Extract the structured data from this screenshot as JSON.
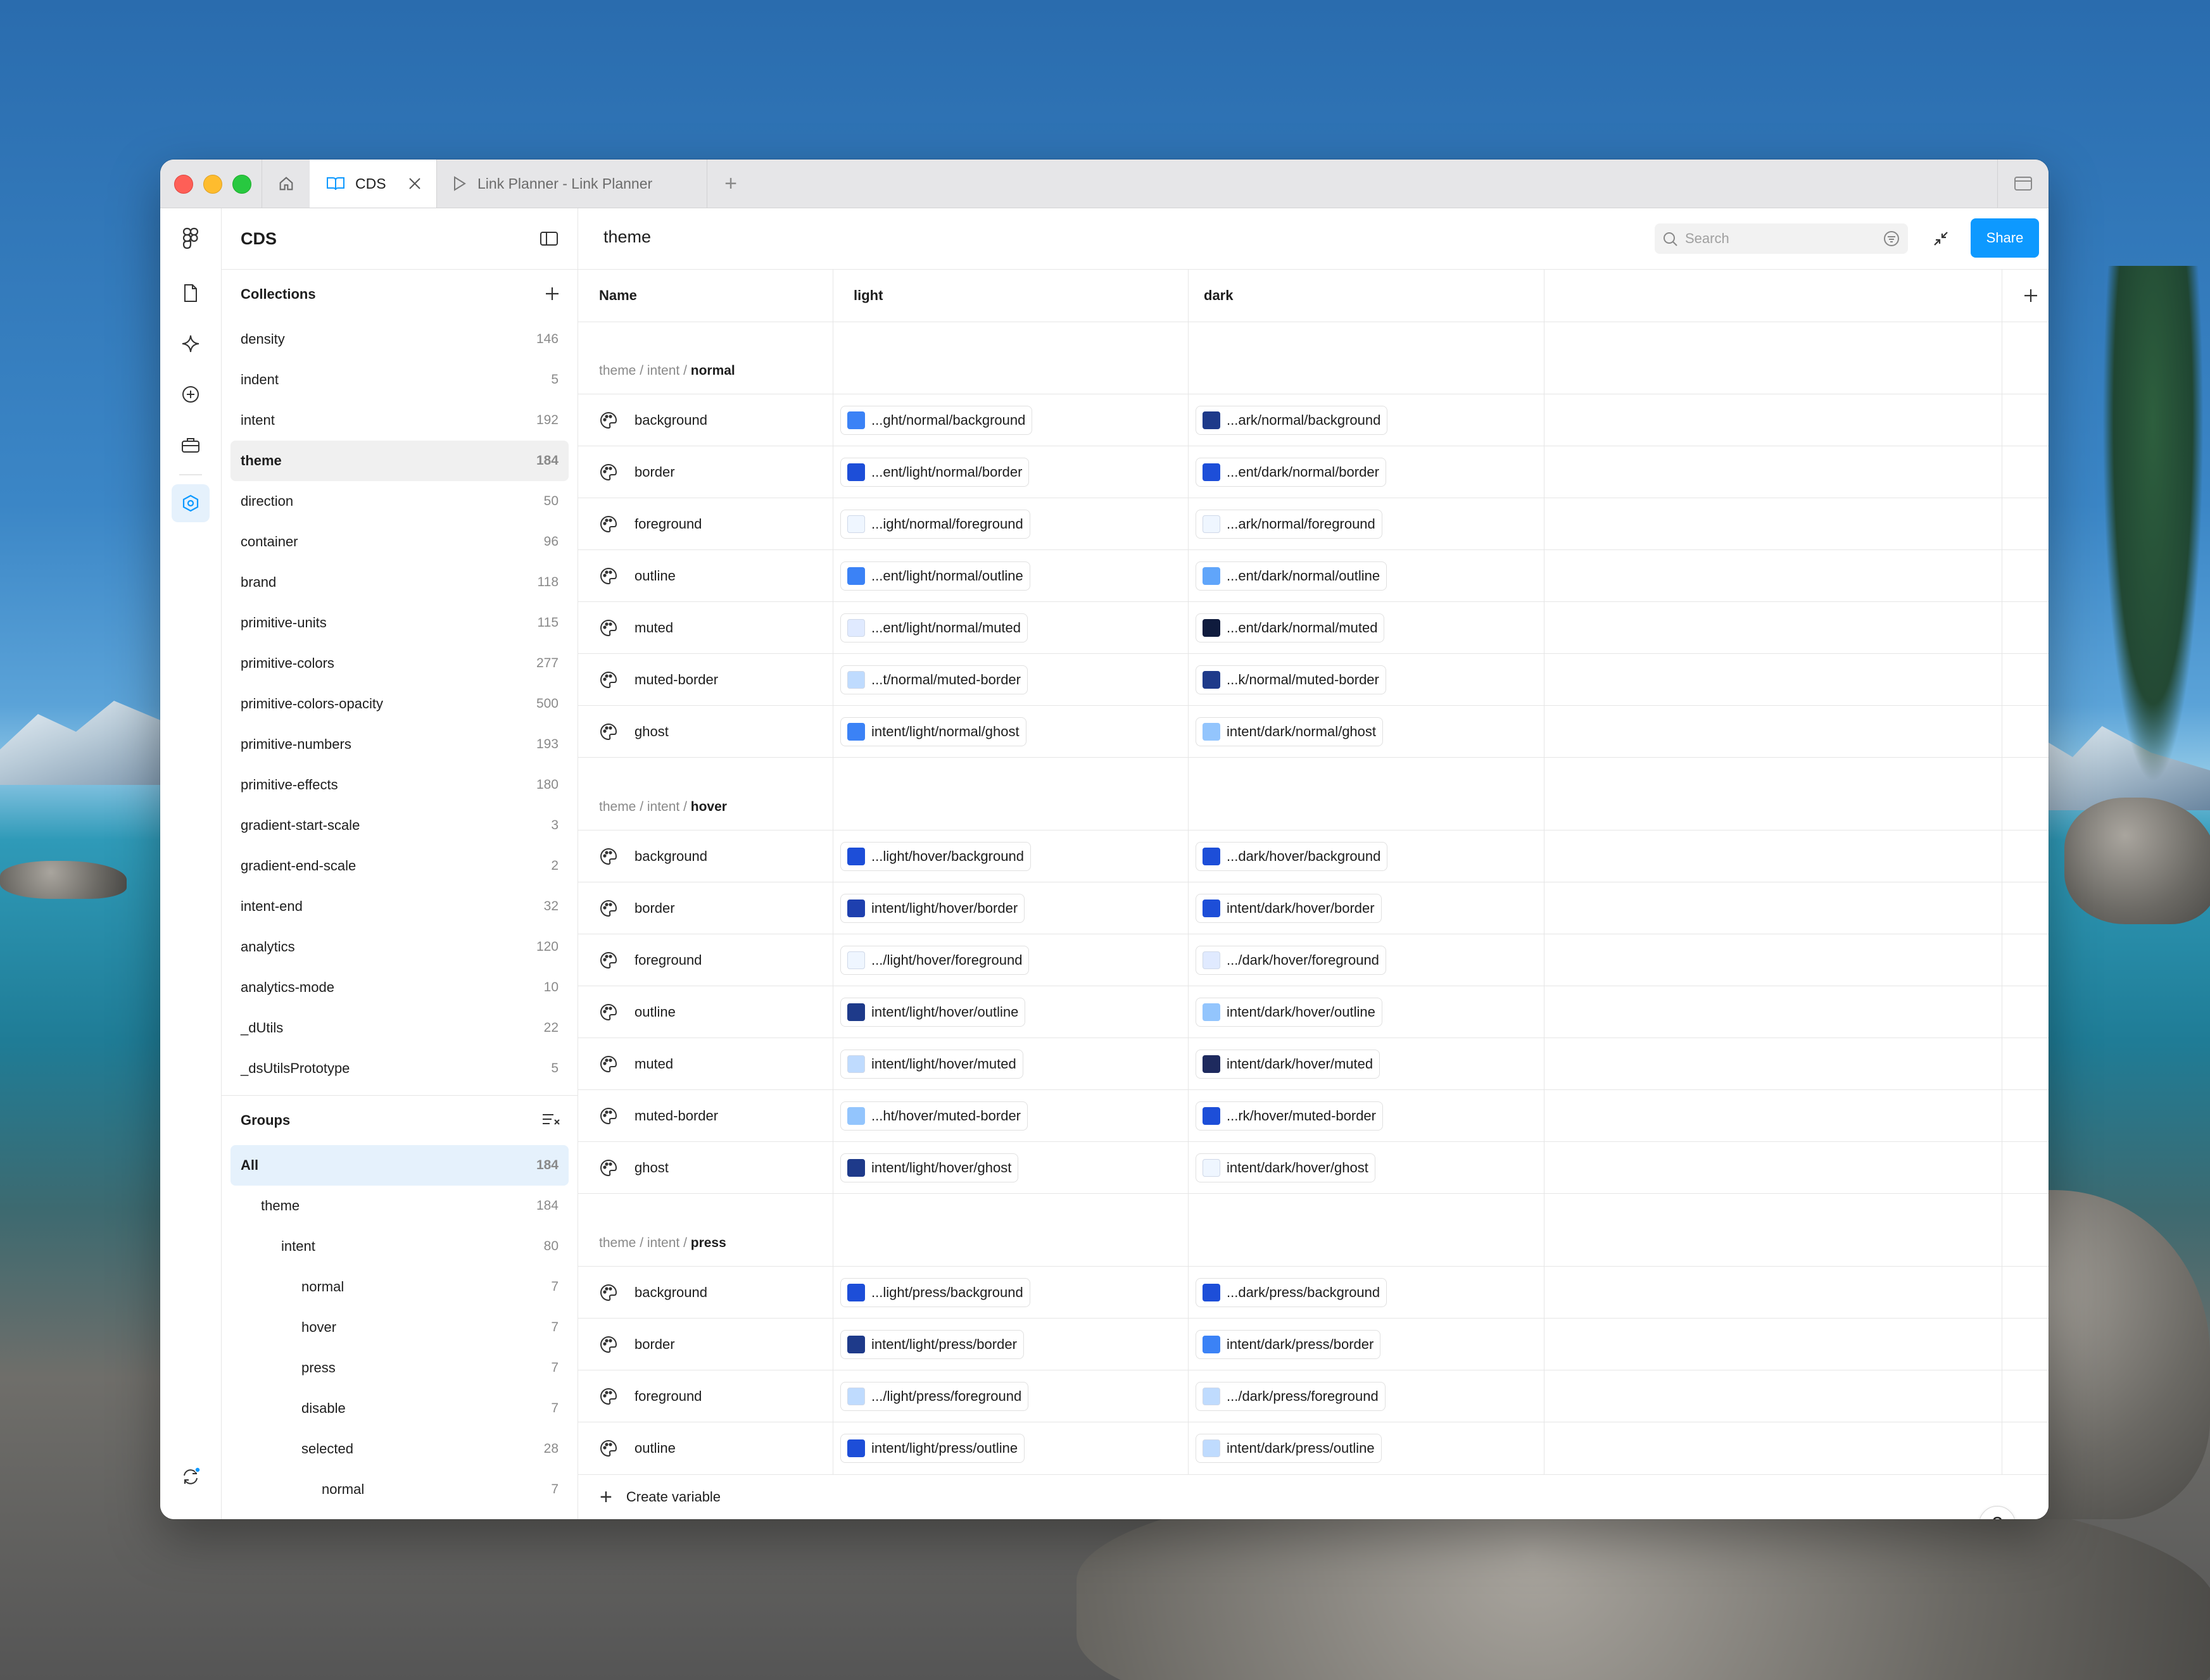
{
  "tabs": {
    "active": "CDS",
    "second": "Link Planner - Link Planner"
  },
  "sidebar": {
    "title": "CDS",
    "collections_label": "Collections",
    "collections": [
      {
        "name": "density",
        "count": "146"
      },
      {
        "name": "indent",
        "count": "5"
      },
      {
        "name": "intent",
        "count": "192"
      },
      {
        "name": "theme",
        "count": "184"
      },
      {
        "name": "direction",
        "count": "50"
      },
      {
        "name": "container",
        "count": "96"
      },
      {
        "name": "brand",
        "count": "118"
      },
      {
        "name": "primitive-units",
        "count": "115"
      },
      {
        "name": "primitive-colors",
        "count": "277"
      },
      {
        "name": "primitive-colors-opacity",
        "count": "500"
      },
      {
        "name": "primitive-numbers",
        "count": "193"
      },
      {
        "name": "primitive-effects",
        "count": "180"
      },
      {
        "name": "gradient-start-scale",
        "count": "3"
      },
      {
        "name": "gradient-end-scale",
        "count": "2"
      },
      {
        "name": "intent-end",
        "count": "32"
      },
      {
        "name": "analytics",
        "count": "120"
      },
      {
        "name": "analytics-mode",
        "count": "10"
      },
      {
        "name": "_dUtils",
        "count": "22"
      },
      {
        "name": "_dsUtilsPrototype",
        "count": "5"
      }
    ],
    "groups_label": "Groups",
    "groups": [
      {
        "name": "All",
        "count": "184",
        "level": 0
      },
      {
        "name": "theme",
        "count": "184",
        "level": 1
      },
      {
        "name": "intent",
        "count": "80",
        "level": 2
      },
      {
        "name": "normal",
        "count": "7",
        "level": 3
      },
      {
        "name": "hover",
        "count": "7",
        "level": 3
      },
      {
        "name": "press",
        "count": "7",
        "level": 3
      },
      {
        "name": "disable",
        "count": "7",
        "level": 3
      },
      {
        "name": "selected",
        "count": "28",
        "level": 3
      },
      {
        "name": "normal",
        "count": "7",
        "level": 4
      }
    ]
  },
  "main": {
    "title": "theme",
    "search_placeholder": "Search",
    "share_label": "Share",
    "columns": {
      "name": "Name",
      "light": "light",
      "dark": "dark"
    },
    "create_label": "Create variable",
    "help": "?"
  },
  "groups": [
    {
      "path": "theme / intent / ",
      "name": "normal",
      "rows": [
        {
          "name": "background",
          "light": "...ght/normal/background",
          "light_color": "#3b82f6",
          "dark": "...ark/normal/background",
          "dark_color": "#1e3a8a"
        },
        {
          "name": "border",
          "light": "...ent/light/normal/border",
          "light_color": "#1d4ed8",
          "dark": "...ent/dark/normal/border",
          "dark_color": "#1d4ed8"
        },
        {
          "name": "foreground",
          "light": "...ight/normal/foreground",
          "light_color": "#eff6ff",
          "dark": "...ark/normal/foreground",
          "dark_color": "#eff6ff"
        },
        {
          "name": "outline",
          "light": "...ent/light/normal/outline",
          "light_color": "#3b82f6",
          "dark": "...ent/dark/normal/outline",
          "dark_color": "#60a5fa"
        },
        {
          "name": "muted",
          "light": "...ent/light/normal/muted",
          "light_color": "#e0eaff",
          "dark": "...ent/dark/normal/muted",
          "dark_color": "#0f1b3d"
        },
        {
          "name": "muted-border",
          "light": "...t/normal/muted-border",
          "light_color": "#bfdbfe",
          "dark": "...k/normal/muted-border",
          "dark_color": "#1e3a8a"
        },
        {
          "name": "ghost",
          "light": "intent/light/normal/ghost",
          "light_color": "#3b82f6",
          "dark": "intent/dark/normal/ghost",
          "dark_color": "#93c5fd"
        }
      ]
    },
    {
      "path": "theme / intent / ",
      "name": "hover",
      "rows": [
        {
          "name": "background",
          "light": "...light/hover/background",
          "light_color": "#1d4ed8",
          "dark": "...dark/hover/background",
          "dark_color": "#1d4ed8"
        },
        {
          "name": "border",
          "light": "intent/light/hover/border",
          "light_color": "#1e40af",
          "dark": "intent/dark/hover/border",
          "dark_color": "#1d4ed8"
        },
        {
          "name": "foreground",
          "light": ".../light/hover/foreground",
          "light_color": "#eff6ff",
          "dark": ".../dark/hover/foreground",
          "dark_color": "#e0eaff"
        },
        {
          "name": "outline",
          "light": "intent/light/hover/outline",
          "light_color": "#1e3a8a",
          "dark": "intent/dark/hover/outline",
          "dark_color": "#93c5fd"
        },
        {
          "name": "muted",
          "light": "intent/light/hover/muted",
          "light_color": "#bfdbfe",
          "dark": "intent/dark/hover/muted",
          "dark_color": "#1e2a5e"
        },
        {
          "name": "muted-border",
          "light": "...ht/hover/muted-border",
          "light_color": "#93c5fd",
          "dark": "...rk/hover/muted-border",
          "dark_color": "#1d4ed8"
        },
        {
          "name": "ghost",
          "light": "intent/light/hover/ghost",
          "light_color": "#1e3a8a",
          "dark": "intent/dark/hover/ghost",
          "dark_color": "#eff6ff"
        }
      ]
    },
    {
      "path": "theme / intent / ",
      "name": "press",
      "rows": [
        {
          "name": "background",
          "light": "...light/press/background",
          "light_color": "#1d4ed8",
          "dark": "...dark/press/background",
          "dark_color": "#1d4ed8"
        },
        {
          "name": "border",
          "light": "intent/light/press/border",
          "light_color": "#1e3a8a",
          "dark": "intent/dark/press/border",
          "dark_color": "#3b82f6"
        },
        {
          "name": "foreground",
          "light": ".../light/press/foreground",
          "light_color": "#bfdbfe",
          "dark": ".../dark/press/foreground",
          "dark_color": "#bfdbfe"
        },
        {
          "name": "outline",
          "light": "intent/light/press/outline",
          "light_color": "#1d4ed8",
          "dark": "intent/dark/press/outline",
          "dark_color": "#bfdbfe"
        }
      ]
    }
  ],
  "colors": {
    "accent": "#0d99ff",
    "selected_group_bg": "#e5f1fc",
    "selected_collection_bg": "#f0f0f0"
  }
}
